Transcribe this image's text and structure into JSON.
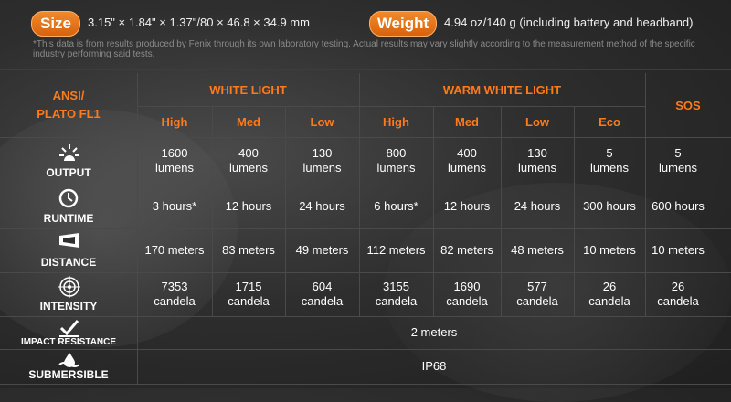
{
  "spec": {
    "size_label": "Size",
    "size_value": "3.15\" × 1.84\" × 1.37\"/80 × 46.8 × 34.9 mm",
    "weight_label": "Weight",
    "weight_value": "4.94 oz/140 g (including battery and headband)",
    "disclaimer": "*This data is from results produced by Fenix through its own laboratory testing. Actual results may vary slightly according to the measurement method of the specific industry performing said tests."
  },
  "table": {
    "corner": "ANSI/\nPLATO FL1",
    "group_white": "WHITE LIGHT",
    "group_warm": "WARM WHITE LIGHT",
    "group_sos": "SOS",
    "modes": [
      "High",
      "Med",
      "Low",
      "High",
      "Med",
      "Low",
      "Eco"
    ],
    "rows": [
      {
        "label": "OUTPUT",
        "icon": "sunburst-icon",
        "values": [
          "1600\nlumens",
          "400\nlumens",
          "130\nlumens",
          "800\nlumens",
          "400\nlumens",
          "130\nlumens",
          "5\nlumens",
          "5\nlumens"
        ]
      },
      {
        "label": "RUNTIME",
        "icon": "clock-icon",
        "values": [
          "3 hours*",
          "12 hours",
          "24 hours",
          "6 hours*",
          "12 hours",
          "24 hours",
          "300 hours",
          "600 hours"
        ]
      },
      {
        "label": "DISTANCE",
        "icon": "beam-icon",
        "values": [
          "170 meters",
          "83 meters",
          "49 meters",
          "112 meters",
          "82 meters",
          "48 meters",
          "10 meters",
          "10 meters"
        ]
      },
      {
        "label": "INTENSITY",
        "icon": "target-icon",
        "values": [
          "7353\ncandela",
          "1715\ncandela",
          "604\ncandela",
          "3155\ncandela",
          "1690\ncandela",
          "577\ncandela",
          "26\ncandela",
          "26\ncandela"
        ]
      }
    ],
    "impact_label": "IMPACT RESISTANCE",
    "impact_value": "2 meters",
    "submersible_label": "SUBMERSIBLE",
    "submersible_value": "IP68"
  },
  "colors": {
    "accent": "#f08a2a",
    "header_text": "#ff7a1a"
  }
}
